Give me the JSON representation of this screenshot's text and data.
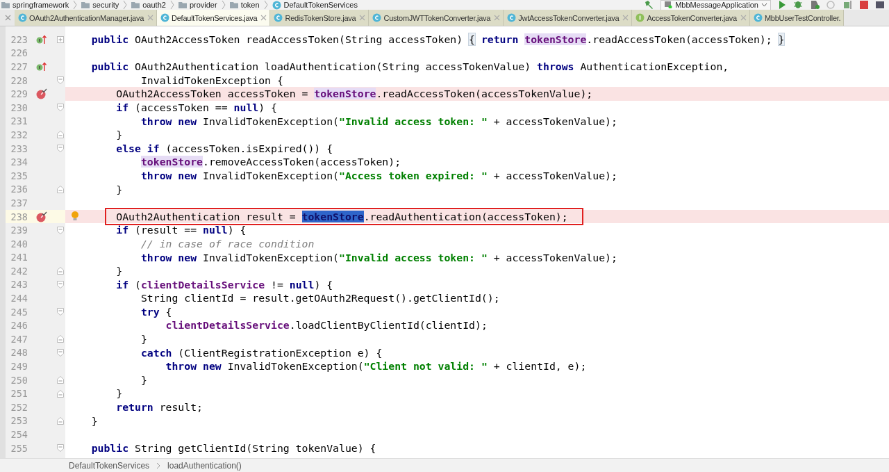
{
  "breadcrumbs": [
    {
      "label": "springframework",
      "kind": "folder"
    },
    {
      "label": "security",
      "kind": "folder"
    },
    {
      "label": "oauth2",
      "kind": "folder"
    },
    {
      "label": "provider",
      "kind": "folder"
    },
    {
      "label": "token",
      "kind": "folder"
    },
    {
      "label": "DefaultTokenServices",
      "kind": "class"
    }
  ],
  "run_config": "MbbMessageApplication",
  "tabs": [
    {
      "label": "OAuth2AuthenticationManager.java",
      "kind": "class",
      "selected": false,
      "closable": true
    },
    {
      "label": "DefaultTokenServices.java",
      "kind": "class",
      "selected": true,
      "closable": true
    },
    {
      "label": "RedisTokenStore.java",
      "kind": "class",
      "selected": false,
      "closable": true
    },
    {
      "label": "CustomJWTTokenConverter.java",
      "kind": "class",
      "selected": false,
      "closable": true
    },
    {
      "label": "JwtAccessTokenConverter.java",
      "kind": "class",
      "selected": false,
      "closable": true
    },
    {
      "label": "AccessTokenConverter.java",
      "kind": "interface",
      "selected": false,
      "closable": true
    },
    {
      "label": "MbbUserTestController.",
      "kind": "class",
      "selected": false
    }
  ],
  "lines": [
    {
      "number": "223",
      "override": true,
      "folded": true,
      "segments": [
        {
          "text": "    public",
          "kind": "keyword"
        },
        {
          "text": " OAuth2AccessToken readAccessToken(String accessToken) ",
          "kind": "plain"
        },
        {
          "text": "{",
          "kind": "fold"
        },
        {
          "text": " return ",
          "kind": "keyword"
        },
        {
          "text": "tokenStore",
          "kind": "usage"
        },
        {
          "text": ".readAccessToken(accessToken); ",
          "kind": "plain"
        },
        {
          "text": "}",
          "kind": "fold"
        }
      ]
    },
    {
      "number": "226"
    },
    {
      "number": "227",
      "override": true,
      "segments": [
        {
          "text": "    public",
          "kind": "keyword"
        },
        {
          "text": " OAuth2Authentication loadAuthentication(String accessTokenValue) ",
          "kind": "plain"
        },
        {
          "text": "throws",
          "kind": "keyword"
        },
        {
          "text": " AuthenticationException,",
          "kind": "plain"
        }
      ]
    },
    {
      "number": "228",
      "fold_start": true,
      "segments": [
        {
          "text": "            InvalidTokenException {",
          "kind": "plain"
        }
      ]
    },
    {
      "number": "229",
      "breakpoint": true,
      "highlighted": true,
      "segments": [
        {
          "text": "        OAuth2AccessToken accessToken = ",
          "kind": "plain"
        },
        {
          "text": "tokenStore",
          "kind": "usage"
        },
        {
          "text": ".readAccessToken(accessTokenValue);",
          "kind": "plain"
        }
      ]
    },
    {
      "number": "230",
      "fold_start": true,
      "segments": [
        {
          "text": "        if",
          "kind": "keyword"
        },
        {
          "text": " (accessToken == ",
          "kind": "plain"
        },
        {
          "text": "null",
          "kind": "keyword"
        },
        {
          "text": ") {",
          "kind": "plain"
        }
      ]
    },
    {
      "number": "231",
      "segments": [
        {
          "text": "            throw new",
          "kind": "keyword"
        },
        {
          "text": " InvalidTokenException(",
          "kind": "plain"
        },
        {
          "text": "\"Invalid access token: \"",
          "kind": "string"
        },
        {
          "text": " + accessTokenValue);",
          "kind": "plain"
        }
      ]
    },
    {
      "number": "232",
      "fold_end": true,
      "segments": [
        {
          "text": "        }",
          "kind": "plain"
        }
      ]
    },
    {
      "number": "233",
      "fold_start": true,
      "segments": [
        {
          "text": "        else if",
          "kind": "keyword"
        },
        {
          "text": " (accessToken.isExpired()) {",
          "kind": "plain"
        }
      ]
    },
    {
      "number": "234",
      "segments": [
        {
          "text": "            tokenStore",
          "kind": "usage"
        },
        {
          "text": ".removeAccessToken(accessToken);",
          "kind": "plain"
        }
      ]
    },
    {
      "number": "235",
      "segments": [
        {
          "text": "            throw new",
          "kind": "keyword"
        },
        {
          "text": " InvalidTokenException(",
          "kind": "plain"
        },
        {
          "text": "\"Access token expired: \"",
          "kind": "string"
        },
        {
          "text": " + accessTokenValue);",
          "kind": "plain"
        }
      ]
    },
    {
      "number": "236",
      "fold_end": true,
      "segments": [
        {
          "text": "        }",
          "kind": "plain"
        }
      ]
    },
    {
      "number": "237"
    },
    {
      "number": "238",
      "breakpoint": true,
      "highlighted": true,
      "current": true,
      "boxed": true,
      "bulb": true,
      "segments": [
        {
          "text": "        OAuth2Authentication result = ",
          "kind": "plain"
        },
        {
          "text": "tokenStore",
          "kind": "selected"
        },
        {
          "text": ".readAuthentication(accessToken);",
          "kind": "plain"
        }
      ]
    },
    {
      "number": "239",
      "fold_start": true,
      "segments": [
        {
          "text": "        if",
          "kind": "keyword"
        },
        {
          "text": " (result == ",
          "kind": "plain"
        },
        {
          "text": "null",
          "kind": "keyword"
        },
        {
          "text": ") {",
          "kind": "plain"
        }
      ]
    },
    {
      "number": "240",
      "segments": [
        {
          "text": "            // in case of race condition",
          "kind": "comment"
        }
      ]
    },
    {
      "number": "241",
      "segments": [
        {
          "text": "            throw new",
          "kind": "keyword"
        },
        {
          "text": " InvalidTokenException(",
          "kind": "plain"
        },
        {
          "text": "\"Invalid access token: \"",
          "kind": "string"
        },
        {
          "text": " + accessTokenValue);",
          "kind": "plain"
        }
      ]
    },
    {
      "number": "242",
      "fold_end": true,
      "segments": [
        {
          "text": "        }",
          "kind": "plain"
        }
      ]
    },
    {
      "number": "243",
      "fold_start": true,
      "segments": [
        {
          "text": "        if",
          "kind": "keyword"
        },
        {
          "text": " (",
          "kind": "plain"
        },
        {
          "text": "clientDetailsService",
          "kind": "field"
        },
        {
          "text": " != ",
          "kind": "plain"
        },
        {
          "text": "null",
          "kind": "keyword"
        },
        {
          "text": ") {",
          "kind": "plain"
        }
      ]
    },
    {
      "number": "244",
      "segments": [
        {
          "text": "            String clientId = result.getOAuth2Request().getClientId();",
          "kind": "plain"
        }
      ]
    },
    {
      "number": "245",
      "fold_start": true,
      "segments": [
        {
          "text": "            try",
          "kind": "keyword"
        },
        {
          "text": " {",
          "kind": "plain"
        }
      ]
    },
    {
      "number": "246",
      "segments": [
        {
          "text": "                clientDetailsService",
          "kind": "field"
        },
        {
          "text": ".loadClientByClientId(clientId);",
          "kind": "plain"
        }
      ]
    },
    {
      "number": "247",
      "fold_end": true,
      "segments": [
        {
          "text": "            }",
          "kind": "plain"
        }
      ]
    },
    {
      "number": "248",
      "fold_start": true,
      "segments": [
        {
          "text": "            catch",
          "kind": "keyword"
        },
        {
          "text": " (ClientRegistrationException e) {",
          "kind": "plain"
        }
      ]
    },
    {
      "number": "249",
      "segments": [
        {
          "text": "                throw new",
          "kind": "keyword"
        },
        {
          "text": " InvalidTokenException(",
          "kind": "plain"
        },
        {
          "text": "\"Client not valid: \"",
          "kind": "string"
        },
        {
          "text": " + clientId, e);",
          "kind": "plain"
        }
      ]
    },
    {
      "number": "250",
      "fold_end": true,
      "segments": [
        {
          "text": "            }",
          "kind": "plain"
        }
      ]
    },
    {
      "number": "251",
      "fold_end": true,
      "segments": [
        {
          "text": "        }",
          "kind": "plain"
        }
      ]
    },
    {
      "number": "252",
      "segments": [
        {
          "text": "        return",
          "kind": "keyword"
        },
        {
          "text": " result;",
          "kind": "plain"
        }
      ]
    },
    {
      "number": "253",
      "fold_end": true,
      "segments": [
        {
          "text": "    }",
          "kind": "plain"
        }
      ]
    },
    {
      "number": "254"
    },
    {
      "number": "255",
      "fold_start": true,
      "segments": [
        {
          "text": "    public",
          "kind": "keyword"
        },
        {
          "text": " String getClientId(String tokenValue) {",
          "kind": "plain"
        }
      ]
    }
  ],
  "footer_breadcrumbs": [
    "DefaultTokenServices",
    "loadAuthentication()"
  ]
}
